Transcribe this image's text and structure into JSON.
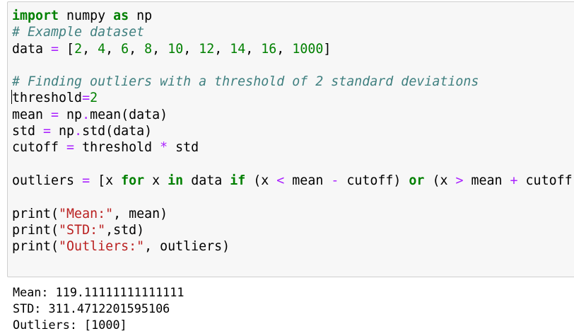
{
  "code_cell": {
    "lines": [
      [
        {
          "t": "import",
          "c": "kw"
        },
        {
          "t": " numpy ",
          "c": "nm"
        },
        {
          "t": "as",
          "c": "kw"
        },
        {
          "t": " np",
          "c": "nm"
        }
      ],
      [
        {
          "t": "# Example dataset",
          "c": "cmt"
        }
      ],
      [
        {
          "t": "data ",
          "c": "nm"
        },
        {
          "t": "=",
          "c": "op"
        },
        {
          "t": " [",
          "c": "nm"
        },
        {
          "t": "2",
          "c": "num"
        },
        {
          "t": ", ",
          "c": "nm"
        },
        {
          "t": "4",
          "c": "num"
        },
        {
          "t": ", ",
          "c": "nm"
        },
        {
          "t": "6",
          "c": "num"
        },
        {
          "t": ", ",
          "c": "nm"
        },
        {
          "t": "8",
          "c": "num"
        },
        {
          "t": ", ",
          "c": "nm"
        },
        {
          "t": "10",
          "c": "num"
        },
        {
          "t": ", ",
          "c": "nm"
        },
        {
          "t": "12",
          "c": "num"
        },
        {
          "t": ", ",
          "c": "nm"
        },
        {
          "t": "14",
          "c": "num"
        },
        {
          "t": ", ",
          "c": "nm"
        },
        {
          "t": "16",
          "c": "num"
        },
        {
          "t": ", ",
          "c": "nm"
        },
        {
          "t": "1000",
          "c": "num"
        },
        {
          "t": "]",
          "c": "nm"
        }
      ],
      [],
      [
        {
          "t": "# Finding outliers with a threshold of 2 standard deviations",
          "c": "cmt"
        }
      ],
      [
        {
          "t": "threshold",
          "c": "nm"
        },
        {
          "t": "=",
          "c": "op"
        },
        {
          "t": "2",
          "c": "num"
        }
      ],
      [
        {
          "t": "mean ",
          "c": "nm"
        },
        {
          "t": "=",
          "c": "op"
        },
        {
          "t": " np",
          "c": "nm"
        },
        {
          "t": ".",
          "c": "op"
        },
        {
          "t": "mean(data)",
          "c": "nm"
        }
      ],
      [
        {
          "t": "std ",
          "c": "nm"
        },
        {
          "t": "=",
          "c": "op"
        },
        {
          "t": " np",
          "c": "nm"
        },
        {
          "t": ".",
          "c": "op"
        },
        {
          "t": "std(data)",
          "c": "nm"
        }
      ],
      [
        {
          "t": "cutoff ",
          "c": "nm"
        },
        {
          "t": "=",
          "c": "op"
        },
        {
          "t": " threshold ",
          "c": "nm"
        },
        {
          "t": "*",
          "c": "op"
        },
        {
          "t": " std",
          "c": "nm"
        }
      ],
      [],
      [
        {
          "t": "outliers ",
          "c": "nm"
        },
        {
          "t": "=",
          "c": "op"
        },
        {
          "t": " [x ",
          "c": "nm"
        },
        {
          "t": "for",
          "c": "kw"
        },
        {
          "t": " x ",
          "c": "nm"
        },
        {
          "t": "in",
          "c": "kw"
        },
        {
          "t": " data ",
          "c": "nm"
        },
        {
          "t": "if",
          "c": "kw"
        },
        {
          "t": " (x ",
          "c": "nm"
        },
        {
          "t": "<",
          "c": "op"
        },
        {
          "t": " mean ",
          "c": "nm"
        },
        {
          "t": "-",
          "c": "op"
        },
        {
          "t": " cutoff) ",
          "c": "nm"
        },
        {
          "t": "or",
          "c": "kw"
        },
        {
          "t": " (x ",
          "c": "nm"
        },
        {
          "t": ">",
          "c": "op"
        },
        {
          "t": " mean ",
          "c": "nm"
        },
        {
          "t": "+",
          "c": "op"
        },
        {
          "t": " cutoff)]",
          "c": "nm"
        }
      ],
      [],
      [
        {
          "t": "print",
          "c": "nm"
        },
        {
          "t": "(",
          "c": "nm"
        },
        {
          "t": "\"Mean:\"",
          "c": "str"
        },
        {
          "t": ", mean)",
          "c": "nm"
        }
      ],
      [
        {
          "t": "print",
          "c": "nm"
        },
        {
          "t": "(",
          "c": "nm"
        },
        {
          "t": "\"STD:\"",
          "c": "str"
        },
        {
          "t": ",std)",
          "c": "nm"
        }
      ],
      [
        {
          "t": "print",
          "c": "nm"
        },
        {
          "t": "(",
          "c": "nm"
        },
        {
          "t": "\"Outliers:\"",
          "c": "str"
        },
        {
          "t": ", outliers)",
          "c": "nm"
        }
      ]
    ],
    "cursor_line": 5
  },
  "output": {
    "lines": [
      "Mean: 119.11111111111111",
      "STD: 311.4712201595106",
      "Outliers: [1000]"
    ]
  },
  "colors": {
    "keyword": "#008000",
    "operator": "#aa22ff",
    "number": "#008000",
    "string": "#ba2121",
    "comment": "#408080",
    "cell_background": "#f7f7f7",
    "cell_border": "#cfcfcf"
  }
}
